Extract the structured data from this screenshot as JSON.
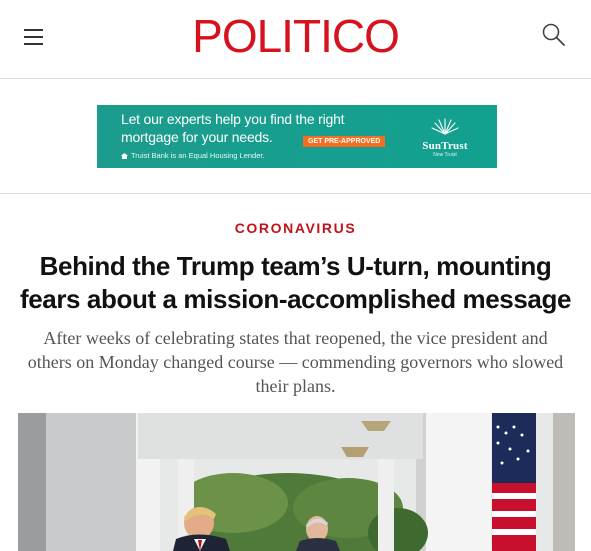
{
  "header": {
    "logo_text": "POLITICO",
    "brand_color": "#d6121e",
    "menu_icon": "hamburger-menu-icon",
    "search_icon": "search-icon"
  },
  "ad": {
    "line1": "Let our experts help you find the right",
    "line2": "mortgage for your needs.",
    "cta": "GET PRE-APPROVED",
    "legal": "Truist Bank is an Equal Housing Lender.",
    "brand_name": "SunTrust",
    "brand_sub": "Now Truist",
    "background_color": "#169f8f"
  },
  "article": {
    "kicker": "CORONAVIRUS",
    "headline": "Behind the Trump team’s U-turn, mounting fears about a mission-accomplished message",
    "dek": "After weeks of celebrating states that reopened, the vice president and others on Monday changed course — commending governors who slowed their plans."
  }
}
